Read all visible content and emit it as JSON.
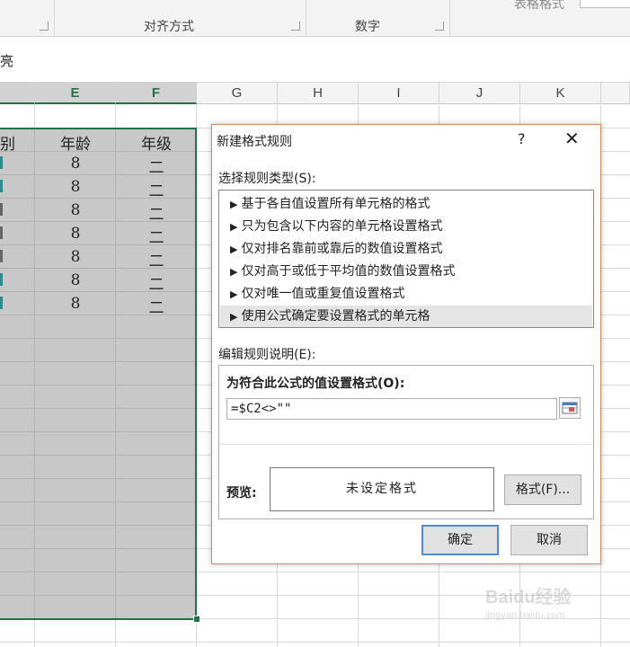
{
  "ribbon": {
    "groups": [
      "对齐方式",
      "数字"
    ],
    "table_format_label": "表格格式"
  },
  "formula_bar": {
    "text": "亮"
  },
  "columns": [
    "E",
    "F",
    "G",
    "H",
    "I",
    "J",
    "K"
  ],
  "sheet": {
    "header_row": {
      "d": "别",
      "e": "年龄",
      "f": "年级"
    },
    "rows": [
      {
        "e": "8",
        "f": "二"
      },
      {
        "e": "8",
        "f": "二"
      },
      {
        "e": "8",
        "f": "二"
      },
      {
        "e": "8",
        "f": "二"
      },
      {
        "e": "8",
        "f": "二"
      },
      {
        "e": "8",
        "f": "二"
      },
      {
        "e": "8",
        "f": "二"
      }
    ]
  },
  "dialog": {
    "title": "新建格式规则",
    "help": "?",
    "close": "✕",
    "select_rule_type_label": "选择规则类型(S):",
    "rule_types": [
      "基于各自值设置所有单元格的格式",
      "只为包含以下内容的单元格设置格式",
      "仅对排名靠前或靠后的数值设置格式",
      "仅对高于或低于平均值的数值设置格式",
      "仅对唯一值或重复值设置格式",
      "使用公式确定要设置格式的单元格"
    ],
    "selected_rule_index": 5,
    "edit_rule_label": "编辑规则说明(E):",
    "formula_label": "为符合此公式的值设置格式(O):",
    "formula_value": "=$C2<>\"\"",
    "preview_label": "预览:",
    "preview_text": "未设定格式",
    "format_button": "格式(F)...",
    "ok_button": "确定",
    "cancel_button": "取消"
  },
  "watermark": {
    "text": "Baidu经验",
    "sub": "jingyan.baidu.com"
  }
}
